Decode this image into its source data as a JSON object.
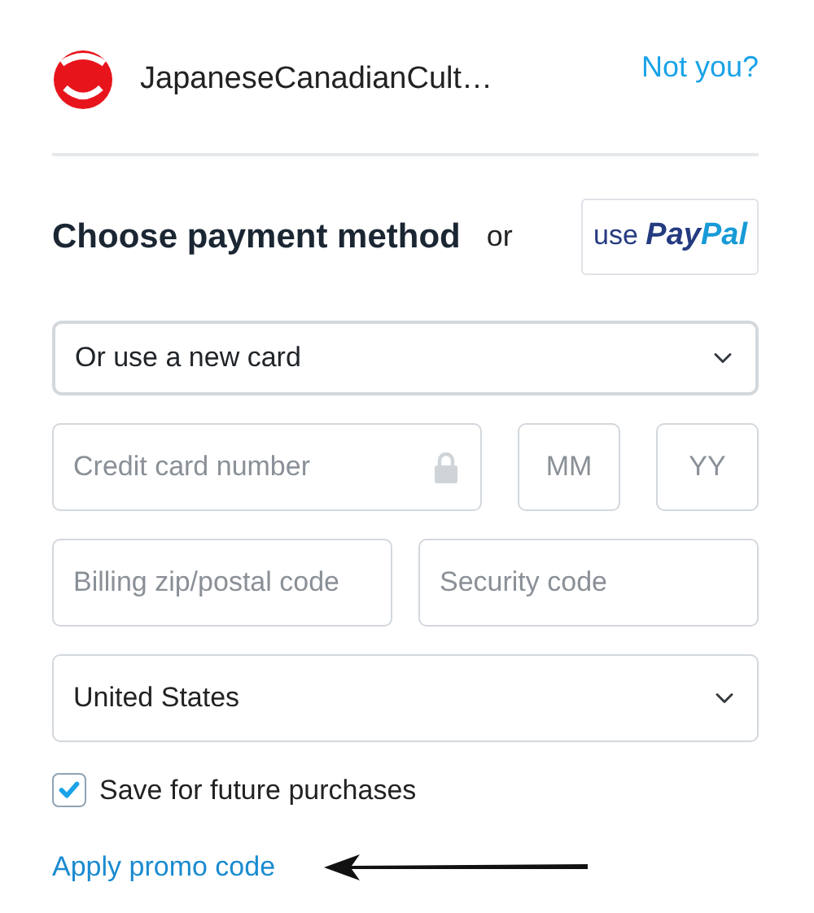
{
  "header": {
    "account_name": "JapaneseCanadianCult…",
    "not_you_link": "Not you?"
  },
  "payment": {
    "heading": "Choose payment method",
    "or_text": "or",
    "paypal_button": {
      "prefix": "use",
      "brand_first": "Pay",
      "brand_second": "Pal"
    }
  },
  "card_select": {
    "value": "Or use a new card"
  },
  "fields": [
    {
      "kind": "card",
      "placeholder": "Credit card number"
    },
    {
      "kind": "short",
      "placeholder": "MM"
    },
    {
      "kind": "short",
      "placeholder": "YY"
    },
    {
      "kind": "half",
      "placeholder": "Billing zip/postal code"
    },
    {
      "kind": "half",
      "placeholder": "Security code"
    }
  ],
  "country_select": {
    "value": "United States"
  },
  "save_checkbox": {
    "label": "Save for future purchases",
    "checked": true
  },
  "promo_link": "Apply promo code",
  "annotation": {
    "kind": "arrow"
  }
}
